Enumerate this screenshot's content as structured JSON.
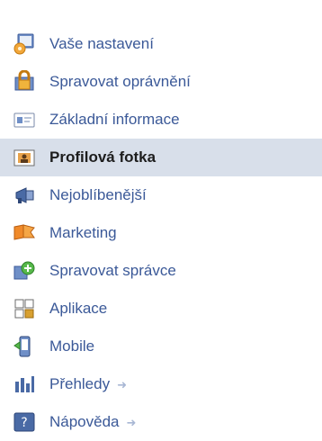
{
  "menu": {
    "items": [
      {
        "label": "Vaše nastavení",
        "icon": "settings-icon"
      },
      {
        "label": "Spravovat oprávnění",
        "icon": "lock-icon"
      },
      {
        "label": "Základní informace",
        "icon": "info-card-icon"
      },
      {
        "label": "Profilová fotka",
        "icon": "profile-photo-icon",
        "selected": true
      },
      {
        "label": "Nejoblíbenější",
        "icon": "megaphone-icon"
      },
      {
        "label": "Marketing",
        "icon": "marketing-flag-icon"
      },
      {
        "label": "Spravovat správce",
        "icon": "admins-icon"
      },
      {
        "label": "Aplikace",
        "icon": "apps-icon"
      },
      {
        "label": "Mobile",
        "icon": "mobile-icon"
      },
      {
        "label": "Přehledy",
        "icon": "insights-icon",
        "arrow": "➜"
      },
      {
        "label": "Nápověda",
        "icon": "help-icon",
        "arrow": "➜"
      }
    ]
  },
  "colors": {
    "link": "#3b5998",
    "selected_bg": "#d8dfea",
    "selected_text": "#1d1d1d"
  }
}
